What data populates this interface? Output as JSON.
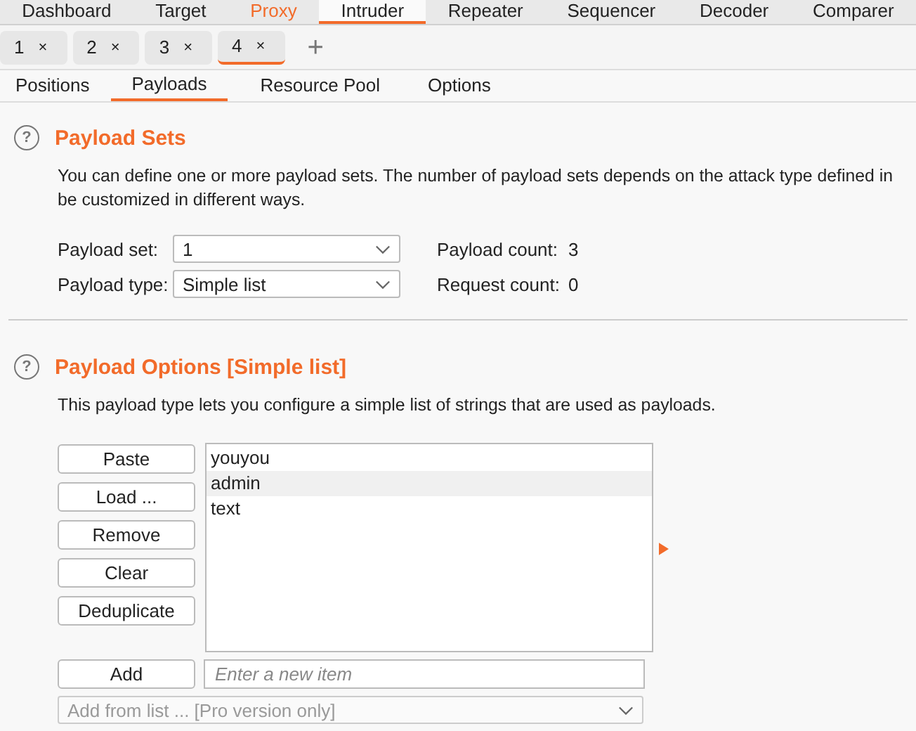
{
  "main_tabs": [
    {
      "label": "Dashboard",
      "selected": false,
      "highlighted": false
    },
    {
      "label": "Target",
      "selected": false,
      "highlighted": false
    },
    {
      "label": "Proxy",
      "selected": false,
      "highlighted": true
    },
    {
      "label": "Intruder",
      "selected": true,
      "highlighted": false
    },
    {
      "label": "Repeater",
      "selected": false,
      "highlighted": false
    },
    {
      "label": "Sequencer",
      "selected": false,
      "highlighted": false
    },
    {
      "label": "Decoder",
      "selected": false,
      "highlighted": false
    },
    {
      "label": "Comparer",
      "selected": false,
      "highlighted": false
    }
  ],
  "attack_tabs": {
    "tabs": [
      {
        "label": "1",
        "close": "×",
        "selected": false
      },
      {
        "label": "2",
        "close": "×",
        "selected": false
      },
      {
        "label": "3",
        "close": "×",
        "selected": false
      },
      {
        "label": "4",
        "close": "×",
        "selected": true
      }
    ],
    "add": "+"
  },
  "sub_tabs": [
    {
      "label": "Positions",
      "selected": false
    },
    {
      "label": "Payloads",
      "selected": true
    },
    {
      "label": "Resource Pool",
      "selected": false
    },
    {
      "label": "Options",
      "selected": false
    }
  ],
  "payload_sets": {
    "help": "?",
    "title": "Payload Sets",
    "description_lines": [
      "You can define one or more payload sets. The number of payload sets depends on the attack type defined in",
      "be customized in different ways."
    ],
    "payload_set": {
      "label": "Payload set:",
      "value": "1"
    },
    "payload_type": {
      "label": "Payload type:",
      "value": "Simple list"
    },
    "payload_count": {
      "label": "Payload count:",
      "value": "3"
    },
    "request_count": {
      "label": "Request count:",
      "value": "0"
    }
  },
  "payload_options": {
    "help": "?",
    "title": "Payload Options [Simple list]",
    "description": "This payload type lets you configure a simple list of strings that are used as payloads.",
    "buttons": [
      "Paste",
      "Load ...",
      "Remove",
      "Clear",
      "Deduplicate"
    ],
    "items": [
      {
        "text": "youyou",
        "selected": false
      },
      {
        "text": "admin",
        "selected": true
      },
      {
        "text": "text",
        "selected": false
      }
    ],
    "add_button": "Add",
    "new_item": {
      "placeholder": "Enter a new item"
    },
    "add_from_list": {
      "value": "Add from list ... [Pro version only]",
      "disabled": true
    }
  }
}
